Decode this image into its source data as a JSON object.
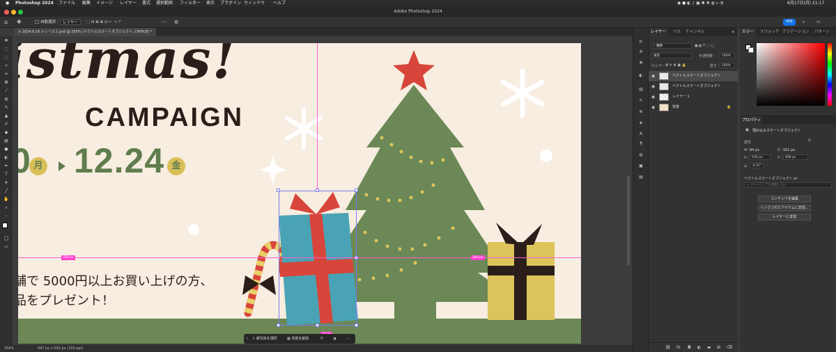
{
  "menubar": {
    "app": "Photoshop 2024",
    "items": [
      "ファイル",
      "編集",
      "イメージ",
      "レイヤー",
      "書式",
      "選択範囲",
      "フィルター",
      "表示",
      "プラグイン",
      "ウィンドウ",
      "ヘルプ"
    ],
    "date_time": "6月17日(月) 21:17"
  },
  "window": {
    "title": "Adobe Photoshop 2024"
  },
  "options": {
    "auto_select_label": "自動選択 :",
    "auto_select_value": "レイヤー",
    "share_label": "共有"
  },
  "document": {
    "tab_title": "2024.6.16.トレース３.psd @ 256% (ベクトルスマートオブジェクト, CMYK/8) *"
  },
  "artboard": {
    "headline": "istmas!",
    "campaign": "CAMPAIGN",
    "date_start_partial": "0",
    "day_start": "月",
    "date_end": "12.24",
    "day_end": "金",
    "line1": "舗で 5000円以上お買い上げの方、",
    "line2": "品をプレゼント！"
  },
  "guides": {
    "left_tag": "328 px",
    "right_tag": "364 px",
    "bottom_tag": "72 px"
  },
  "context_bar": {
    "select_subject": "被写体を選択",
    "remove_bg": "背景を削除"
  },
  "status": {
    "zoom": "256%",
    "size": "697 px x 592 px (150 ppi)"
  },
  "layers_panel": {
    "tabs": [
      "レイヤー",
      "パス",
      "チャンネル"
    ],
    "filter": "種類",
    "blend_mode": "通常",
    "opacity_label": "不透明度 :",
    "opacity_value": "100%",
    "lock_label": "ロック :",
    "fill_label": "塗り :",
    "fill_value": "100%",
    "layers": [
      {
        "name": "ベクトルスマートオブジェクト",
        "selected": true
      },
      {
        "name": "ベクトルスマートオブジェクト",
        "selected": false
      },
      {
        "name": "レイヤー 1",
        "selected": false
      },
      {
        "name": "背景",
        "selected": false
      }
    ]
  },
  "color_panel": {
    "tabs": [
      "カラー",
      "スウォッチ",
      "グラデーション",
      "パターン"
    ]
  },
  "properties": {
    "tab": "プロパティ",
    "object_type": "埋め込みスマートオブジェクト",
    "transform_label": "変形",
    "w": "94 px",
    "h": "161 px",
    "x": "526 px",
    "y": "408 px",
    "angle": "-4.15°",
    "source_file": "ベクトルスマートオブジェクト.ai",
    "layer_comp_placeholder": "レイヤーカンプを適用しない",
    "btn_edit": "コンテンツを編集",
    "btn_convert_linked": "リンクされたアイテムに変換...",
    "btn_convert_layer": "レイヤーに変換",
    "labels": {
      "w": "W :",
      "h": "H :",
      "x": "X :",
      "y": "Y :"
    }
  },
  "colors": {
    "accent": "#1473e6",
    "guide": "#ff5cd6",
    "tree": "#6b8856",
    "gift_blue": "#4aa3b5",
    "ribbon_red": "#d8453a",
    "gift_yellow": "#dcc45a",
    "cream": "#f7ede0"
  }
}
